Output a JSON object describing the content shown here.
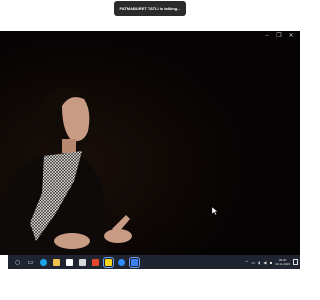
{
  "meeting": {
    "speaker_indicator": "FATMABURET TATLI is talking..."
  },
  "window_controls": {
    "minimize_icon": "minimize-icon",
    "restore_icon": "restore-icon",
    "close_icon": "close-icon"
  },
  "taskbar": {
    "icons": [
      {
        "name": "start-button"
      },
      {
        "name": "search-icon",
        "glyph": "○"
      },
      {
        "name": "task-view-icon",
        "glyph": "▭"
      },
      {
        "name": "edge-icon",
        "color": "#1ea7e8"
      },
      {
        "name": "file-explorer-icon",
        "color": "#f2c14b"
      },
      {
        "name": "mail-icon",
        "color": "#ffffff"
      },
      {
        "name": "store-icon",
        "color": "#d9d9d9"
      },
      {
        "name": "office-icon",
        "color": "#e2482d"
      },
      {
        "name": "sticky-notes-icon",
        "color": "#f7d51d"
      },
      {
        "name": "zoom-icon",
        "color": "#2d8cff"
      },
      {
        "name": "meeting-app-icon",
        "color": "#3b82f6"
      }
    ],
    "tray": {
      "clock_time": "09:00",
      "clock_date": "30.11.2020"
    }
  }
}
